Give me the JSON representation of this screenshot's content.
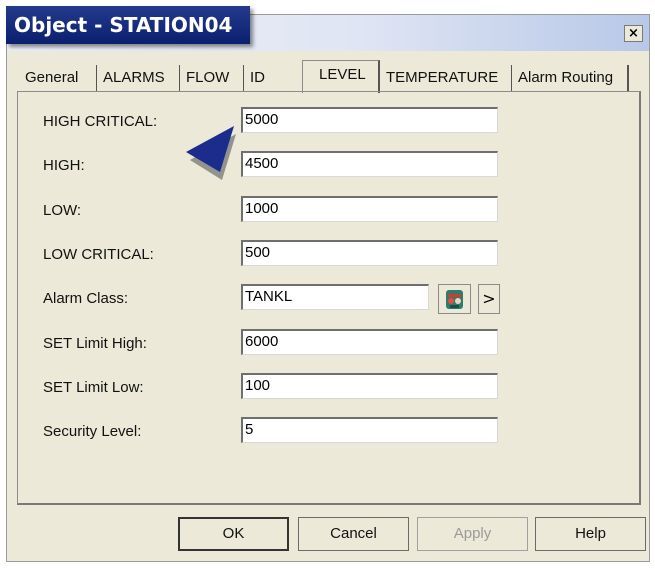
{
  "window": {
    "title": "Object - STATION04",
    "close_glyph": "×"
  },
  "tabs": [
    {
      "label": "General"
    },
    {
      "label": "ALARMS"
    },
    {
      "label": "FLOW"
    },
    {
      "label": "ID"
    },
    {
      "label": "LEVEL",
      "active": true
    },
    {
      "label": "TEMPERATURE"
    },
    {
      "label": "Alarm Routing"
    }
  ],
  "fields": [
    {
      "label": "HIGH CRITICAL:",
      "value": "5000"
    },
    {
      "label": "HIGH:",
      "value": "4500"
    },
    {
      "label": "LOW:",
      "value": "1000"
    },
    {
      "label": "LOW CRITICAL:",
      "value": "500"
    },
    {
      "label": "Alarm Class:",
      "value": "TANKL"
    },
    {
      "label": "SET Limit High:",
      "value": "6000"
    },
    {
      "label": "SET Limit Low:",
      "value": "100"
    },
    {
      "label": "Security Level:",
      "value": "5"
    }
  ],
  "alarm_class_buttons": {
    "browse_icon": "alarm-class-icon",
    "arrow": ">"
  },
  "buttons": {
    "ok": "OK",
    "cancel": "Cancel",
    "apply": "Apply",
    "help": "Help"
  },
  "colors": {
    "title_badge": "#0a1f6e",
    "dialog_bg": "#ece9d8",
    "pointer": "#1c2c8c"
  }
}
